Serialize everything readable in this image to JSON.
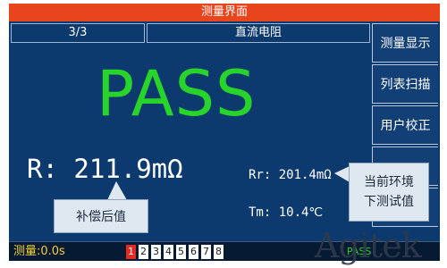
{
  "title": "测量界面",
  "header": {
    "page": "3/3",
    "mode": "直流电阻"
  },
  "side_menu": [
    {
      "label": "测量显示"
    },
    {
      "label": "列表扫描"
    },
    {
      "label": "用户校正"
    },
    {
      "label": ""
    },
    {
      "label": ""
    }
  ],
  "result": "PASS",
  "measurement": {
    "r": "R: 211.9mΩ",
    "rr": "Rr: 201.4mΩ",
    "tm": "Tm: 10.4℃"
  },
  "callouts": {
    "compensated": "补偿后值",
    "env_line1": "当前环境",
    "env_line2": "下测试值"
  },
  "status": {
    "label": "测量:0.0s",
    "channels": [
      "1",
      "2",
      "3",
      "4",
      "5",
      "6",
      "7",
      "8"
    ],
    "active_channel": "1",
    "result": "PASS"
  },
  "watermark": "Agitek",
  "colors": {
    "screen_bg": "#0c3a6e",
    "title_bar": "#e8451c",
    "pass_green": "#28d42a",
    "active_channel": "#e22a22",
    "status_text": "#f4d13a"
  }
}
